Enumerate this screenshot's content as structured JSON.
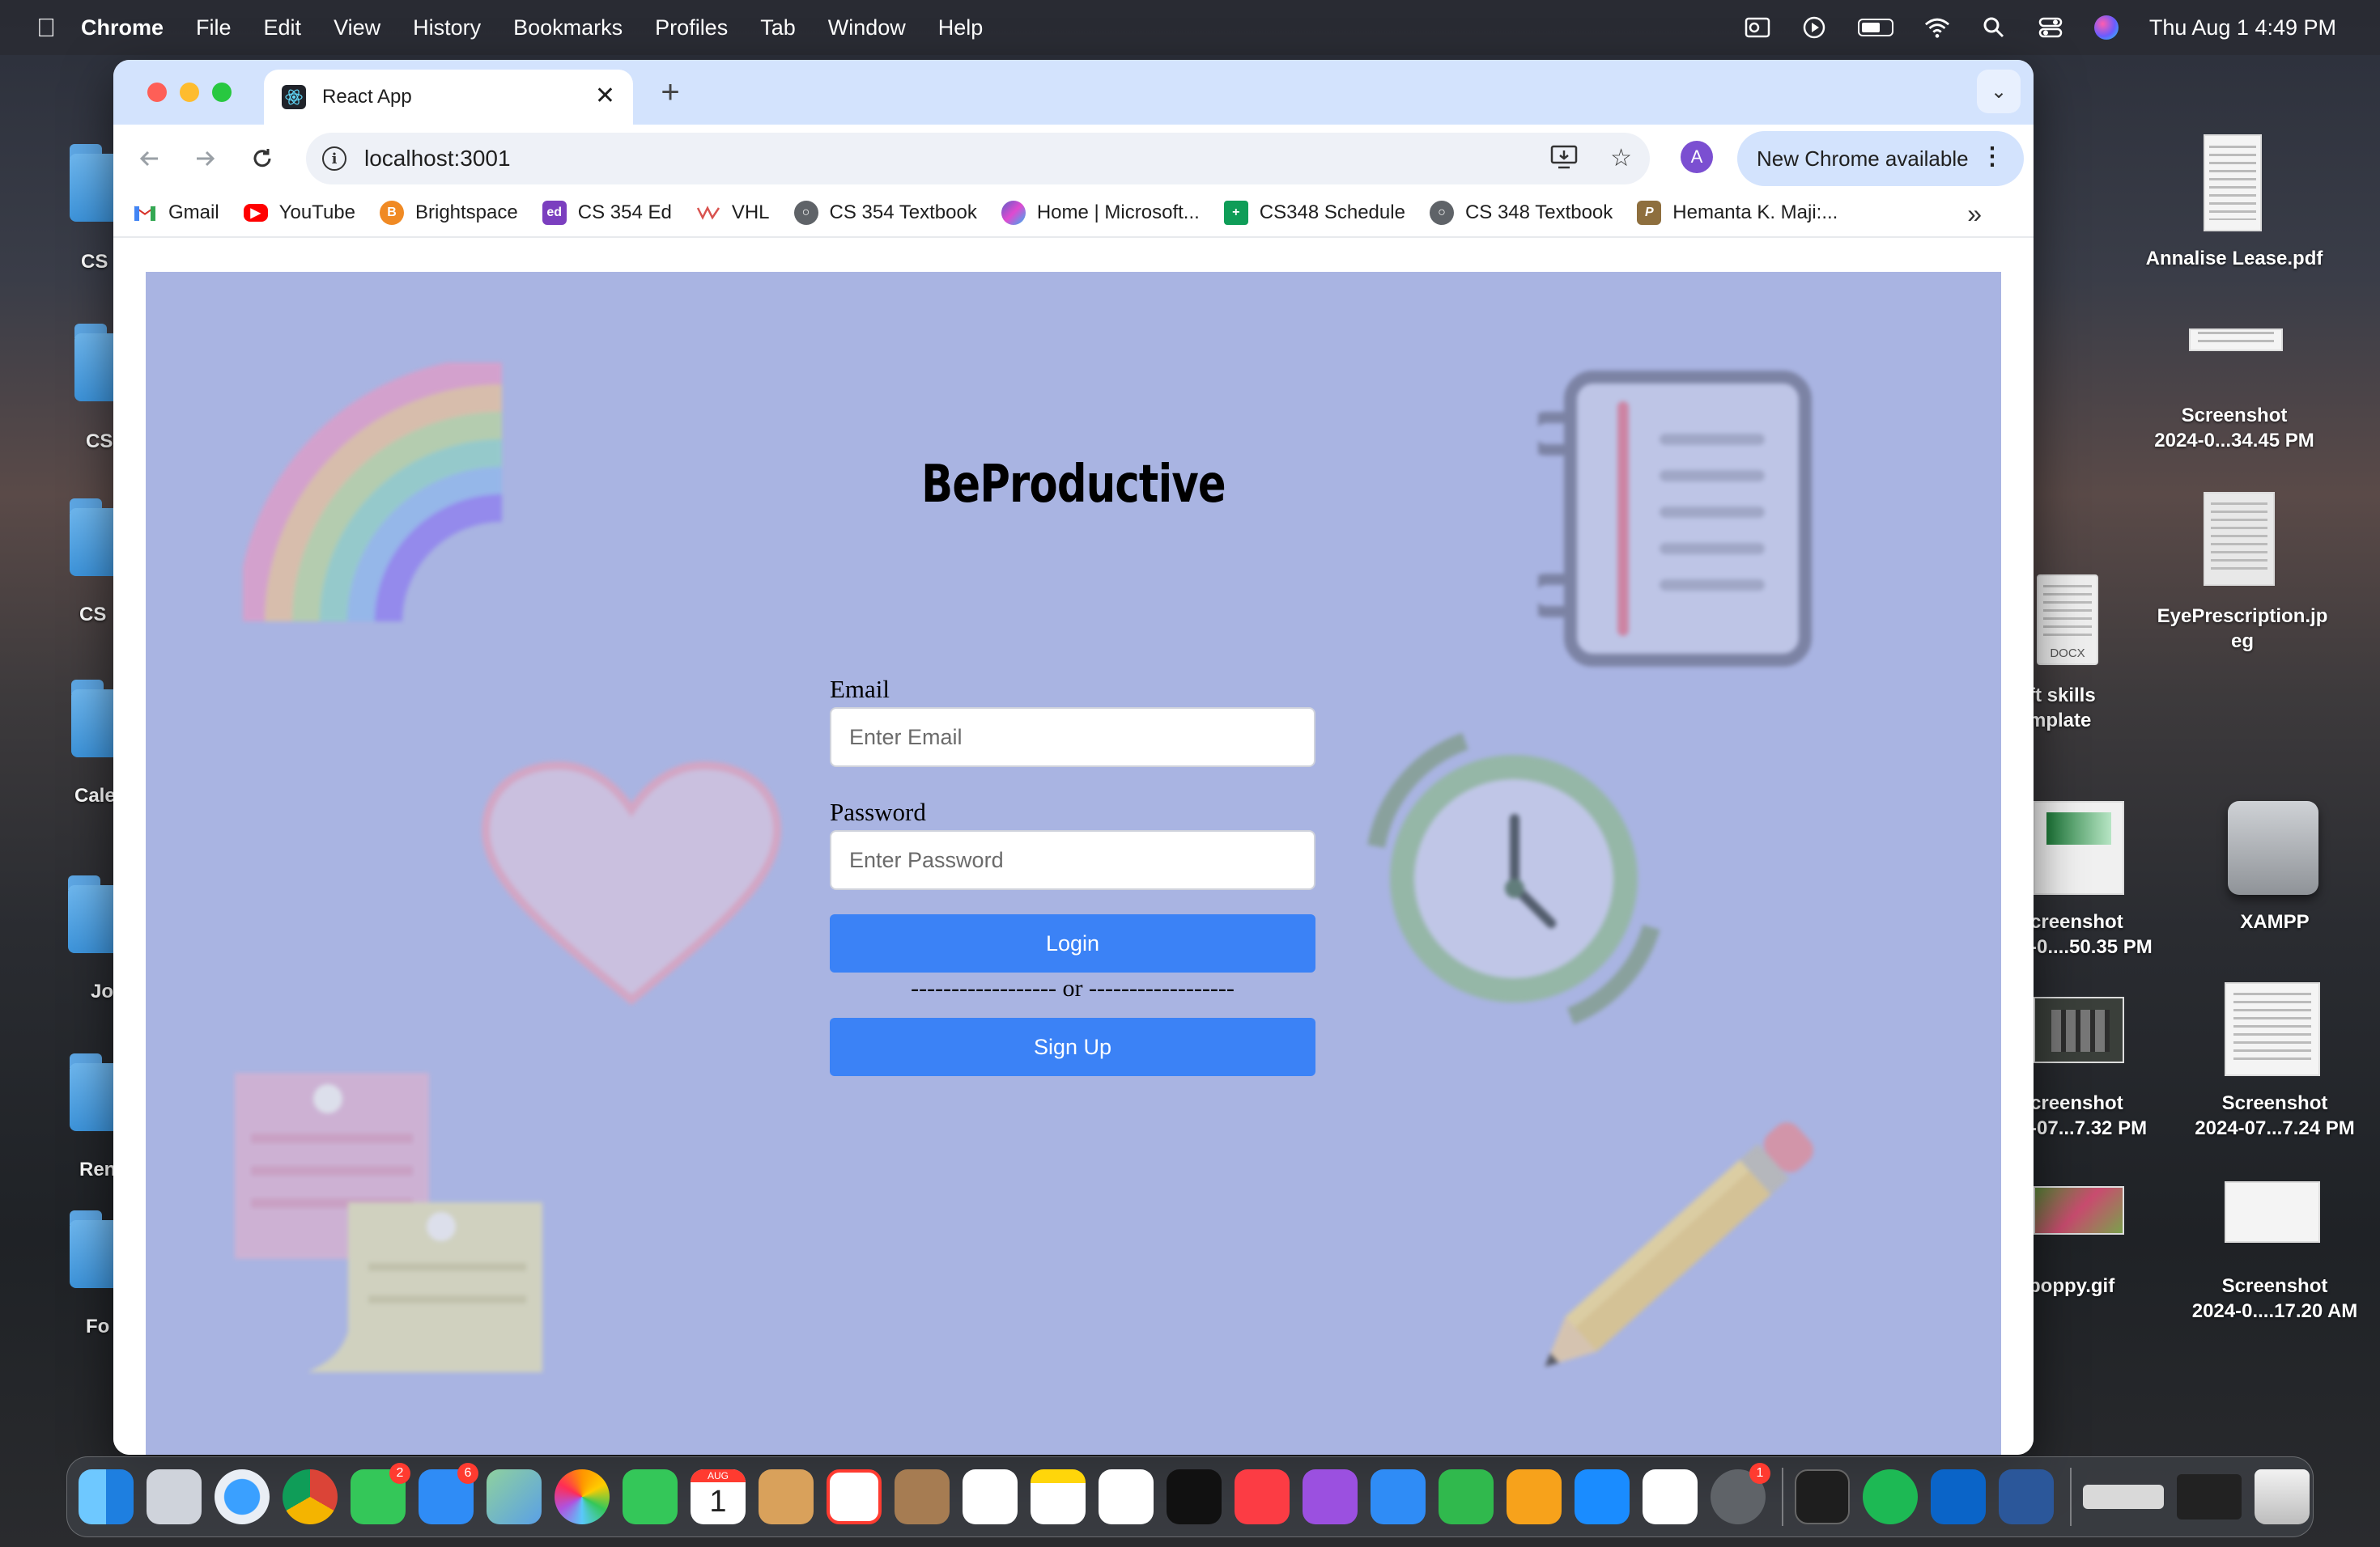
{
  "menubar": {
    "app": "Chrome",
    "menus": [
      "File",
      "Edit",
      "View",
      "History",
      "Bookmarks",
      "Profiles",
      "Tab",
      "Window",
      "Help"
    ],
    "clock": "Thu Aug 1  4:49 PM"
  },
  "desktop": {
    "left_labels": [
      "CS",
      "CS",
      "CS",
      "Cale",
      "Jo",
      "Ren",
      "Fo"
    ],
    "right_items": [
      {
        "label": "Annalise Lease.pdf"
      },
      {
        "label": "Screenshot\n2024-0...34.45 PM"
      },
      {
        "label": "EyePrescription.jp\neg"
      },
      {
        "label": "ft skills\nmplate"
      },
      {
        "label": "creenshot\n-0....50.35 PM"
      },
      {
        "label": "XAMPP"
      },
      {
        "label": "creenshot\n-07...7.32 PM"
      },
      {
        "label": "Screenshot\n2024-07...7.24 PM"
      },
      {
        "label": "poppy.gif"
      },
      {
        "label": "Screenshot\n2024-0....17.20 AM"
      }
    ],
    "docx_badge": "DOCX"
  },
  "browser": {
    "tab_title": "React App",
    "url": "localhost:3001",
    "profile_initial": "A",
    "update_label": "New Chrome available",
    "bookmarks": [
      {
        "label": "Gmail",
        "icon": "gmail-icon",
        "color": "#ea4335"
      },
      {
        "label": "YouTube",
        "icon": "youtube-icon",
        "color": "#ff0000"
      },
      {
        "label": "Brightspace",
        "icon": "brightspace-icon",
        "color": "#f08a24"
      },
      {
        "label": "CS 354 Ed",
        "icon": "ed-icon",
        "color": "#7b3fbf"
      },
      {
        "label": "VHL",
        "icon": "vhl-icon",
        "color": "#d9534f"
      },
      {
        "label": "CS 354 Textbook",
        "icon": "globe-icon",
        "color": "#5f6368"
      },
      {
        "label": "Home | Microsoft...",
        "icon": "microsoft-icon",
        "color": "#5b5fc7"
      },
      {
        "label": "CS348 Schedule",
        "icon": "sheets-icon",
        "color": "#0f9d58"
      },
      {
        "label": "CS 348 Textbook",
        "icon": "globe-icon",
        "color": "#5f6368"
      },
      {
        "label": "Hemanta K. Maji:...",
        "icon": "purdue-icon",
        "color": "#8e6f3e"
      }
    ]
  },
  "app": {
    "brand": "BeProductive",
    "email_label": "Email",
    "email_placeholder": "Enter Email",
    "password_label": "Password",
    "password_placeholder": "Enter Password",
    "login_label": "Login",
    "divider": "------------------ or ------------------",
    "signup_label": "Sign Up",
    "background_color": "#a9b4e2",
    "button_color": "#3b82f6"
  },
  "dock": {
    "badges": {
      "messages": "2",
      "mail": "6",
      "settings": "1"
    },
    "calendar_month": "AUG",
    "calendar_day": "1"
  }
}
